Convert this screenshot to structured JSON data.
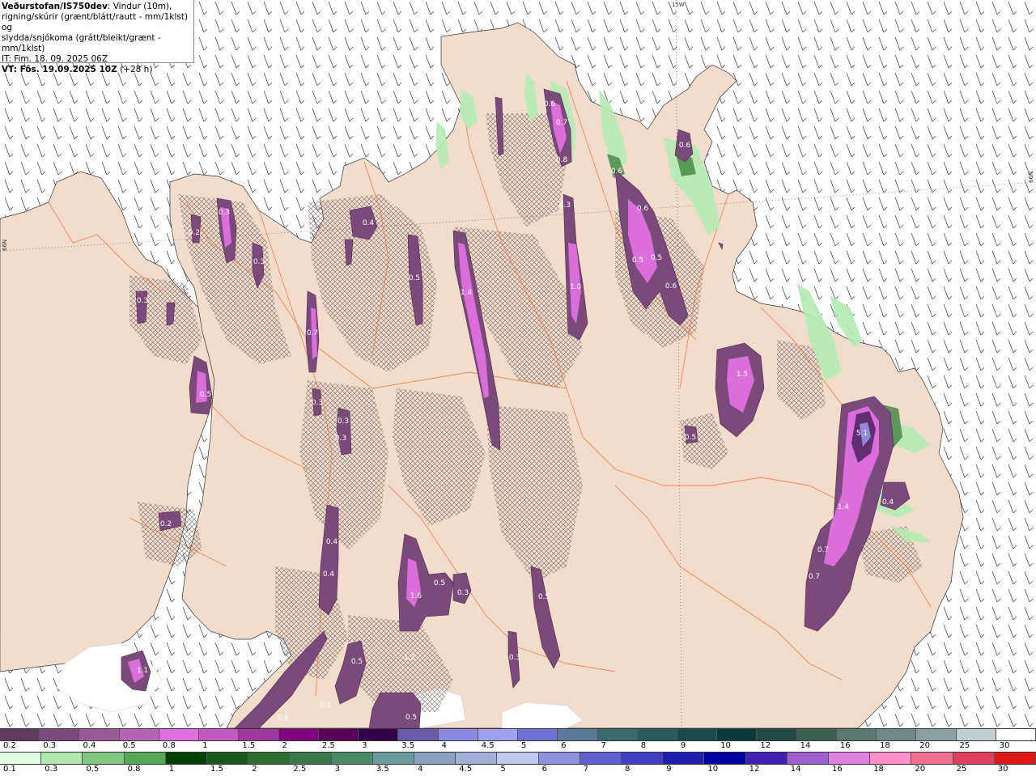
{
  "header": {
    "source": "Veðurstofan/IS750dev",
    "desc1": ": Vindur (10m),",
    "desc2": "rigning/skúrir (grænt/blátt/rautt - mm/1klst) og",
    "desc3": "slydda/snjókoma (grátt/bleikt/grænt - mm/1klst)",
    "it": "IT: Fim. 18. 09. 2025 06Z",
    "vt_label": "VT: Fös. 19.09.2025 10Z",
    "vt_offset": "(+28 h)"
  },
  "grid_labels": {
    "top": "15W",
    "left": "66N",
    "right": "66N"
  },
  "map_labels": [
    "0.3",
    "0.4",
    "0.5",
    "0.3",
    "0.2",
    "0.7",
    "0.5",
    "0.3",
    "0.3",
    "0.3",
    "1.4",
    "0.6",
    "0.7",
    "0.8",
    "0.3",
    "1.0",
    "0.6",
    "0.5",
    "0.5",
    "0.6",
    "0.6",
    "1.5",
    "0.5",
    "5.1",
    "1.4",
    "0.4",
    "0.7",
    "0.7",
    "0.2",
    "0.4",
    "0.4",
    "1.6",
    "0.5",
    "0.3",
    "0.5",
    "0.3",
    "0.5",
    "1.2",
    "0.6",
    "0.3",
    "0.5",
    "1.1",
    "0.3",
    "0.6"
  ],
  "legend_top": {
    "labels": [
      "0.2",
      "0.3",
      "0.4",
      "0.5",
      "0.8",
      "1",
      "1.5",
      "2",
      "2.5",
      "3",
      "3.5",
      "4",
      "4.5",
      "5",
      "6",
      "7",
      "8",
      "9",
      "10",
      "12",
      "14",
      "16",
      "18",
      "20",
      "25",
      "30"
    ],
    "colors": [
      "#5e3a5e",
      "#7d4a7d",
      "#9a5a9a",
      "#b466b4",
      "#e070e0",
      "#c25ac2",
      "#a038a0",
      "#800080",
      "#580058",
      "#33004a",
      "#6a5aaa",
      "#8a8ae0",
      "#a0a0f0",
      "#7070d0",
      "#5a7a9a",
      "#3a6a6a",
      "#2a5a5a",
      "#1a4a4a",
      "#0a3a3a",
      "#224a44",
      "#3a6050",
      "#5a7870",
      "#708888",
      "#8aa0a0",
      "#c0d0d0",
      "#ffffff"
    ]
  },
  "legend_bottom": {
    "labels": [
      "0.1",
      "0.3",
      "0.5",
      "0.8",
      "1",
      "1.5",
      "2",
      "2.5",
      "3",
      "3.5",
      "4",
      "4.5",
      "5",
      "6",
      "7",
      "8",
      "9",
      "10",
      "12",
      "14",
      "16",
      "18",
      "20",
      "25",
      "30"
    ],
    "colors": [
      "#e0ffe0",
      "#b0e8b0",
      "#80c880",
      "#58a858",
      "#004000",
      "#1a5a1a",
      "#2e6e2e",
      "#3a7a4a",
      "#4a8a6a",
      "#6a9a9a",
      "#8aa0c0",
      "#a0b0d8",
      "#c0c8f0",
      "#9090e0",
      "#6060d0",
      "#4040c0",
      "#2020b0",
      "#0000a0",
      "#4020b0",
      "#a060d0",
      "#e080e0",
      "#ff90c8",
      "#f07090",
      "#e04060",
      "#e01818"
    ]
  }
}
